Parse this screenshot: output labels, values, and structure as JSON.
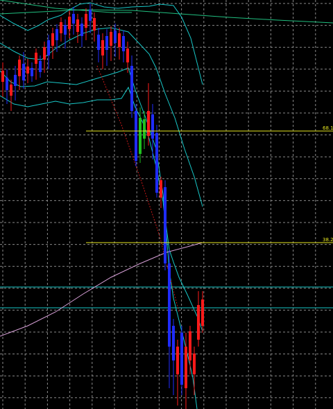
{
  "chart_data": {
    "type": "candlestick",
    "grid": true,
    "grid_color": "#8a8a8a",
    "background": "#000000",
    "up_color": "#1f2cff",
    "down_color": "#ff1a1a",
    "doji_color": "#20c020",
    "band_color": "#18c8c8",
    "long_ma_color": "#20c080",
    "ma_color": "#d8a0d8",
    "level_color": "#e8e820",
    "fib_levels": [
      {
        "label": "68.1",
        "color": "#e8e820"
      },
      {
        "label": "38.2",
        "color": "#e8e820"
      }
    ]
  }
}
